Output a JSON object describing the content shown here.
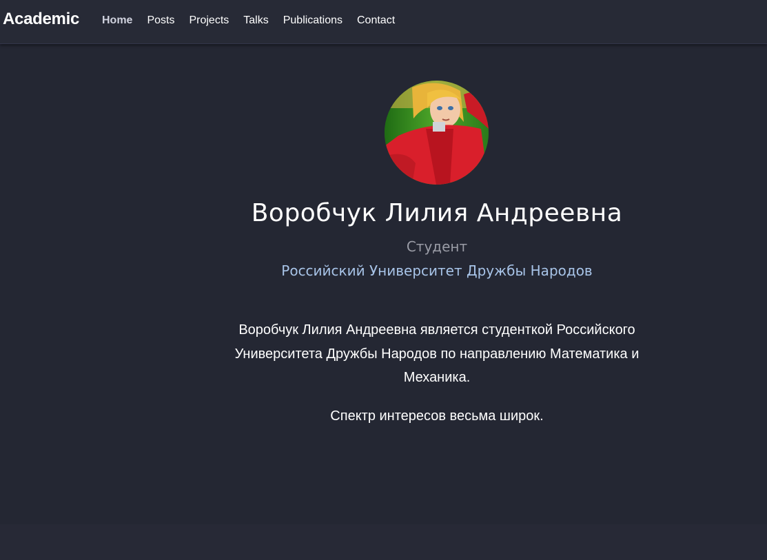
{
  "navbar": {
    "brand": "Academic",
    "items": [
      {
        "label": "Home",
        "active": true
      },
      {
        "label": "Posts"
      },
      {
        "label": "Projects"
      },
      {
        "label": "Talks"
      },
      {
        "label": "Publications"
      },
      {
        "label": "Contact"
      }
    ]
  },
  "profile": {
    "name": "Воробчук Лилия Андреевна",
    "role": "Студент",
    "organization": "Российский Университет Дружбы Народов",
    "bio": [
      "Воробчук Лилия Андреевна является студенткой Российского Университета Дружбы Народов по направлению Математика и Механика.",
      "Спектр интересов весьма широк."
    ]
  }
}
